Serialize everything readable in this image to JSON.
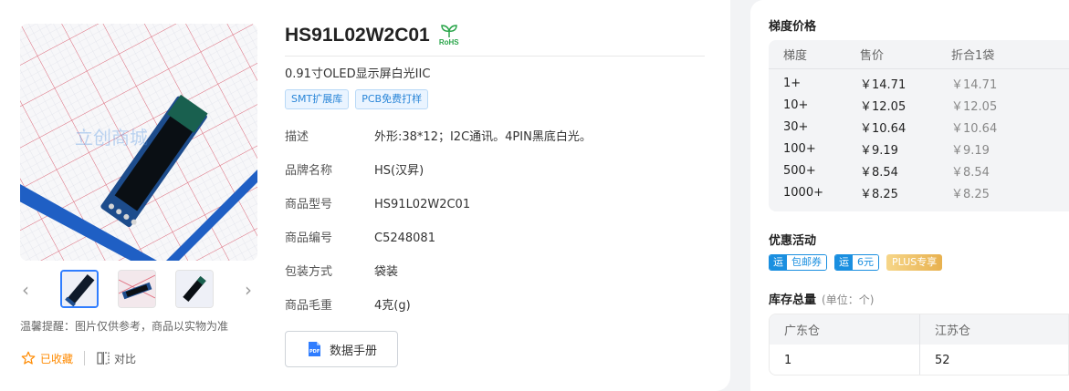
{
  "product": {
    "title": "HS91L02W2C01",
    "rohs_label": "RoHS",
    "subtitle": "0.91寸OLED显示屏白光IIC",
    "tags": [
      "SMT扩展库",
      "PCB免费打样"
    ],
    "attributes": [
      {
        "key": "描述",
        "value": "外形:38*12；I2C通讯。4PIN黑底白光。"
      },
      {
        "key": "品牌名称",
        "value": "HS(汉昇)"
      },
      {
        "key": "商品型号",
        "value": "HS91L02W2C01"
      },
      {
        "key": "商品编号",
        "value": "C5248081"
      },
      {
        "key": "包装方式",
        "value": "袋装"
      },
      {
        "key": "商品毛重",
        "value": "4克(g)"
      }
    ],
    "datasheet_label": "数据手册"
  },
  "gallery": {
    "watermark": "立创商城",
    "warm_tip": "温馨提醒：图片仅供参考，商品以实物为准",
    "favorite_label": "已收藏",
    "compare_label": "对比",
    "prev_arrow": "‹",
    "next_arrow": "›"
  },
  "pricing": {
    "title": "梯度价格",
    "headers": [
      "梯度",
      "售价",
      "折合1袋"
    ],
    "rows": [
      {
        "qty": "1+",
        "price": "￥14.71",
        "per_bag": "￥14.71"
      },
      {
        "qty": "10+",
        "price": "￥12.05",
        "per_bag": "￥12.05"
      },
      {
        "qty": "30+",
        "price": "￥10.64",
        "per_bag": "￥10.64"
      },
      {
        "qty": "100+",
        "price": "￥9.19",
        "per_bag": "￥9.19"
      },
      {
        "qty": "500+",
        "price": "￥8.54",
        "per_bag": "￥8.54"
      },
      {
        "qty": "1000+",
        "price": "￥8.25",
        "per_bag": "￥8.25"
      }
    ]
  },
  "promotions": {
    "title": "优惠活动",
    "coupons": [
      {
        "badge": "运",
        "text": "包邮券"
      },
      {
        "badge": "运",
        "text": "6元"
      }
    ],
    "plus_label": "PLUS专享"
  },
  "stock": {
    "title": "库存总量",
    "unit": "(单位：个)",
    "headers": [
      "广东仓",
      "江苏仓"
    ],
    "values": [
      "1",
      "52"
    ]
  },
  "colors": {
    "accent_blue": "#2f7dff",
    "tag_blue": "#2a86d8",
    "favorite_orange": "#ff8a00",
    "rohs_green": "#2aa54a"
  }
}
